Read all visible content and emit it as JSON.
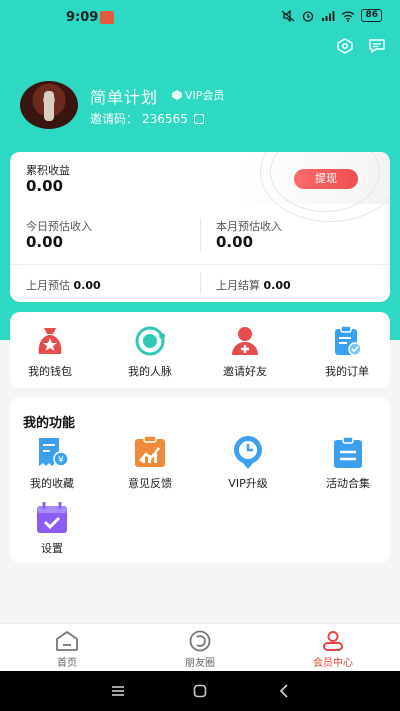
{
  "status_bar": {
    "time": "9:09",
    "battery": "86"
  },
  "profile": {
    "username": "简单计划",
    "vip_label": "VIP会员",
    "invite_label": "邀请码：",
    "invite_code": "236565"
  },
  "earnings": {
    "total_label": "累积收益",
    "total_value": "0.00",
    "withdraw_label": "提现",
    "today_label": "今日预估收入",
    "today_value": "0.00",
    "month_label": "本月预估收入",
    "month_value": "0.00",
    "last_month_est_label": "上月预估",
    "last_month_est_value": "0.00",
    "last_month_settle_label": "上月结算",
    "last_month_settle_value": "0.00"
  },
  "quick_actions": [
    {
      "label": "我的钱包",
      "icon": "wallet-icon"
    },
    {
      "label": "我的人脉",
      "icon": "network-icon"
    },
    {
      "label": "邀请好友",
      "icon": "invite-friend-icon"
    },
    {
      "label": "我的订单",
      "icon": "order-icon"
    }
  ],
  "functions": {
    "title": "我的功能",
    "items": [
      {
        "label": "我的收藏",
        "icon": "favorites-icon"
      },
      {
        "label": "意见反馈",
        "icon": "feedback-icon"
      },
      {
        "label": "VIP升级",
        "icon": "vip-upgrade-icon"
      },
      {
        "label": "活动合集",
        "icon": "activity-icon"
      },
      {
        "label": "设置",
        "icon": "settings-icon"
      }
    ]
  },
  "bottom_nav": [
    {
      "label": "首页",
      "icon": "home-icon"
    },
    {
      "label": "朋友圈",
      "icon": "moments-icon"
    },
    {
      "label": "会员中心",
      "icon": "member-icon",
      "active": true
    }
  ],
  "colors": {
    "header_teal": "#2dd9c3",
    "accent_red": "#e8443f",
    "icon_blue": "#3aa0ef",
    "icon_orange": "#f08a3a",
    "icon_purple": "#8b5cf6"
  }
}
